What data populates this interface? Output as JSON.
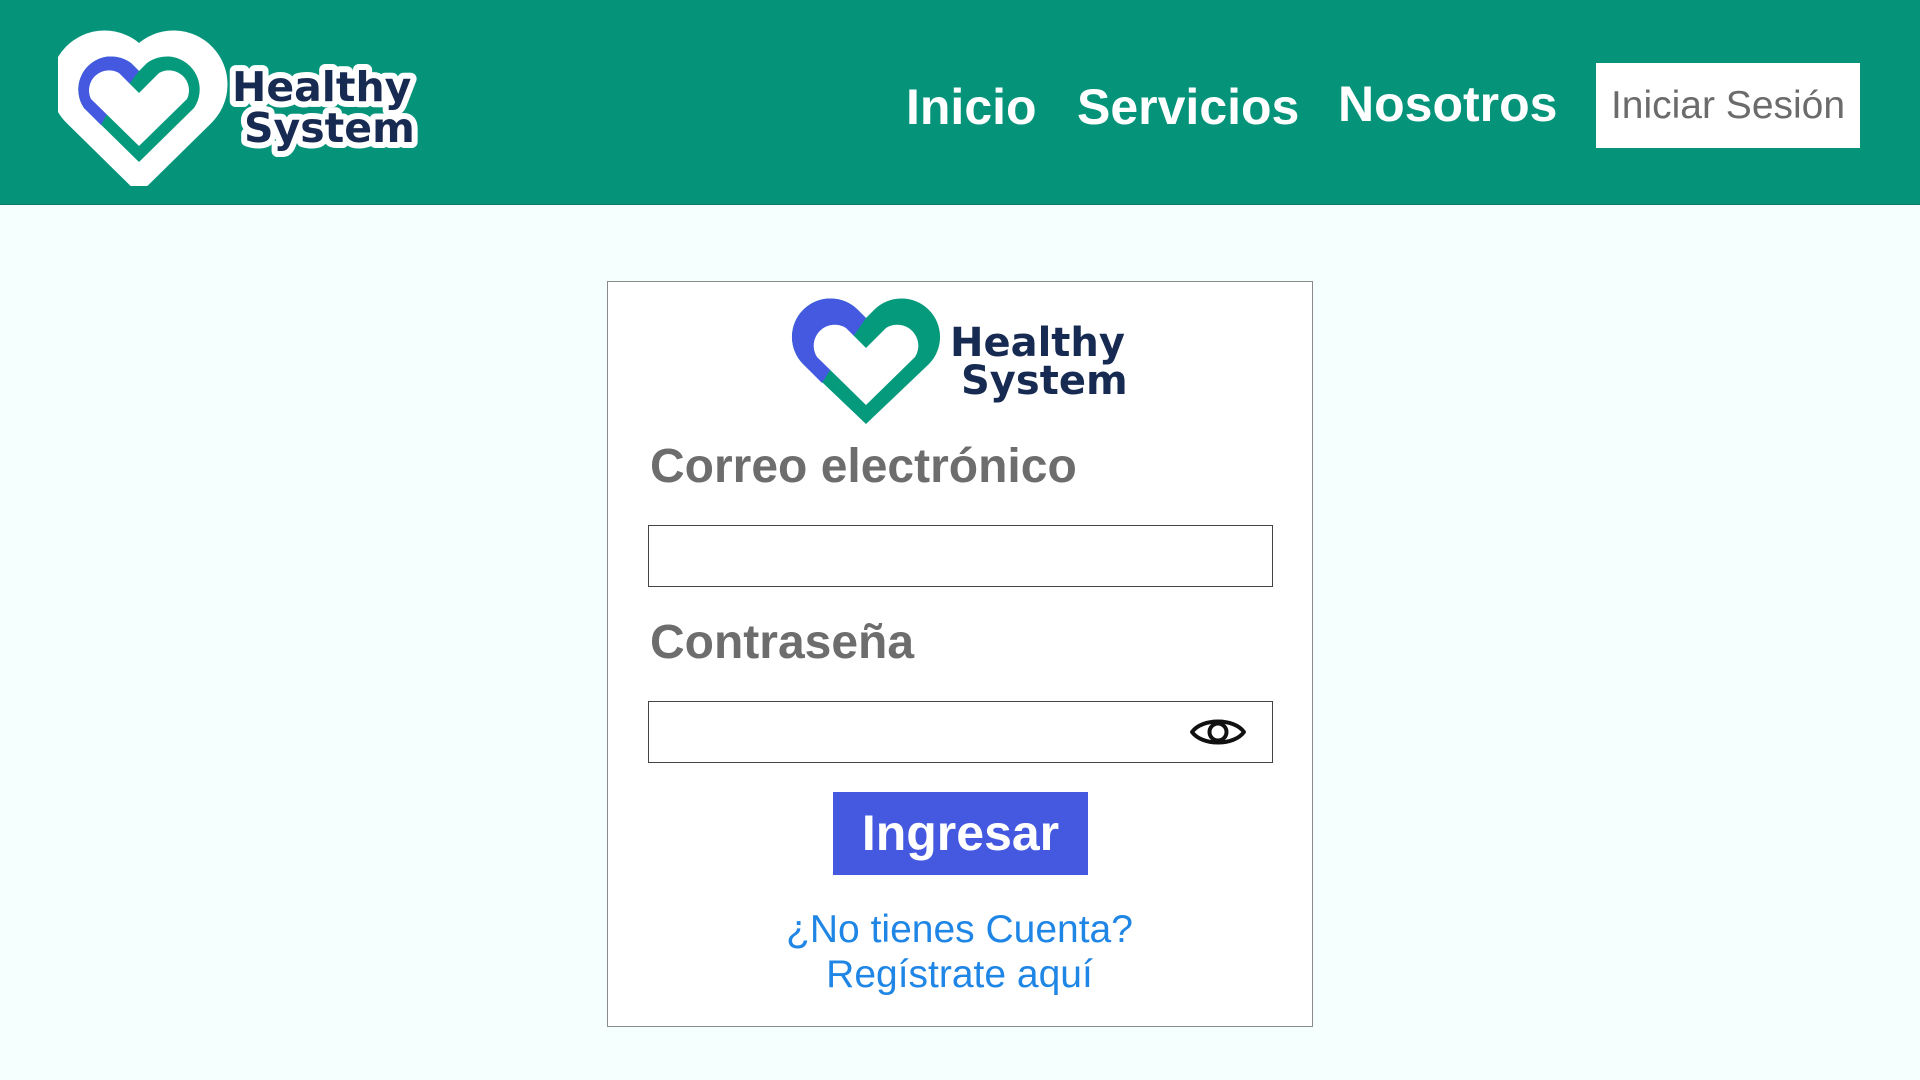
{
  "brand": {
    "name_line1": "Healthy",
    "name_line2": "System",
    "colors": {
      "header": "#05947a",
      "heart_blue": "#4459e0",
      "heart_green": "#069a7c",
      "wordmark": "#172a52"
    }
  },
  "nav": {
    "items": [
      {
        "label": "Inicio"
      },
      {
        "label": "Servicios"
      },
      {
        "label": "Nosotros"
      }
    ],
    "login_label": "Iniciar Sesión"
  },
  "form": {
    "email_label": "Correo electrónico",
    "email_value": "",
    "password_label": "Contraseña",
    "password_value": "",
    "password_toggle_icon": "eye-icon",
    "submit_label": "Ingresar",
    "register_question": "¿No tienes Cuenta?",
    "register_link": "Regístrate aquí"
  }
}
